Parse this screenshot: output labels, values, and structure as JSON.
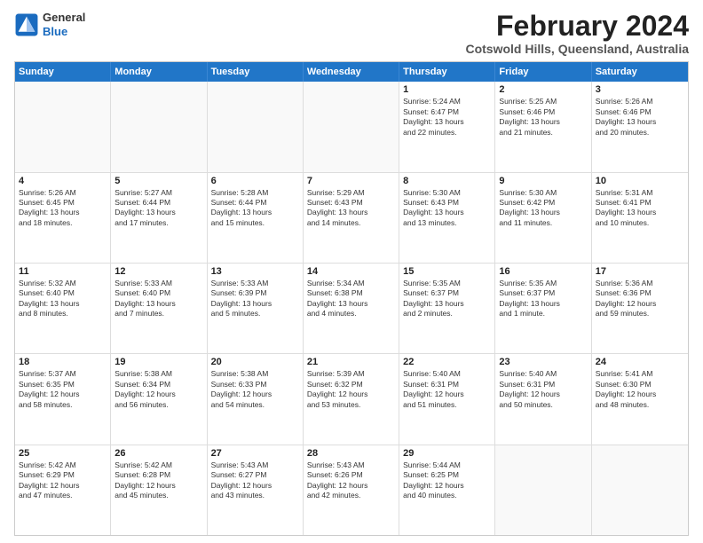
{
  "logo": {
    "line1": "General",
    "line2": "Blue"
  },
  "title": "February 2024",
  "subtitle": "Cotswold Hills, Queensland, Australia",
  "days": [
    "Sunday",
    "Monday",
    "Tuesday",
    "Wednesday",
    "Thursday",
    "Friday",
    "Saturday"
  ],
  "rows": [
    [
      {
        "day": "",
        "text": ""
      },
      {
        "day": "",
        "text": ""
      },
      {
        "day": "",
        "text": ""
      },
      {
        "day": "",
        "text": ""
      },
      {
        "day": "1",
        "text": "Sunrise: 5:24 AM\nSunset: 6:47 PM\nDaylight: 13 hours\nand 22 minutes."
      },
      {
        "day": "2",
        "text": "Sunrise: 5:25 AM\nSunset: 6:46 PM\nDaylight: 13 hours\nand 21 minutes."
      },
      {
        "day": "3",
        "text": "Sunrise: 5:26 AM\nSunset: 6:46 PM\nDaylight: 13 hours\nand 20 minutes."
      }
    ],
    [
      {
        "day": "4",
        "text": "Sunrise: 5:26 AM\nSunset: 6:45 PM\nDaylight: 13 hours\nand 18 minutes."
      },
      {
        "day": "5",
        "text": "Sunrise: 5:27 AM\nSunset: 6:44 PM\nDaylight: 13 hours\nand 17 minutes."
      },
      {
        "day": "6",
        "text": "Sunrise: 5:28 AM\nSunset: 6:44 PM\nDaylight: 13 hours\nand 15 minutes."
      },
      {
        "day": "7",
        "text": "Sunrise: 5:29 AM\nSunset: 6:43 PM\nDaylight: 13 hours\nand 14 minutes."
      },
      {
        "day": "8",
        "text": "Sunrise: 5:30 AM\nSunset: 6:43 PM\nDaylight: 13 hours\nand 13 minutes."
      },
      {
        "day": "9",
        "text": "Sunrise: 5:30 AM\nSunset: 6:42 PM\nDaylight: 13 hours\nand 11 minutes."
      },
      {
        "day": "10",
        "text": "Sunrise: 5:31 AM\nSunset: 6:41 PM\nDaylight: 13 hours\nand 10 minutes."
      }
    ],
    [
      {
        "day": "11",
        "text": "Sunrise: 5:32 AM\nSunset: 6:40 PM\nDaylight: 13 hours\nand 8 minutes."
      },
      {
        "day": "12",
        "text": "Sunrise: 5:33 AM\nSunset: 6:40 PM\nDaylight: 13 hours\nand 7 minutes."
      },
      {
        "day": "13",
        "text": "Sunrise: 5:33 AM\nSunset: 6:39 PM\nDaylight: 13 hours\nand 5 minutes."
      },
      {
        "day": "14",
        "text": "Sunrise: 5:34 AM\nSunset: 6:38 PM\nDaylight: 13 hours\nand 4 minutes."
      },
      {
        "day": "15",
        "text": "Sunrise: 5:35 AM\nSunset: 6:37 PM\nDaylight: 13 hours\nand 2 minutes."
      },
      {
        "day": "16",
        "text": "Sunrise: 5:35 AM\nSunset: 6:37 PM\nDaylight: 13 hours\nand 1 minute."
      },
      {
        "day": "17",
        "text": "Sunrise: 5:36 AM\nSunset: 6:36 PM\nDaylight: 12 hours\nand 59 minutes."
      }
    ],
    [
      {
        "day": "18",
        "text": "Sunrise: 5:37 AM\nSunset: 6:35 PM\nDaylight: 12 hours\nand 58 minutes."
      },
      {
        "day": "19",
        "text": "Sunrise: 5:38 AM\nSunset: 6:34 PM\nDaylight: 12 hours\nand 56 minutes."
      },
      {
        "day": "20",
        "text": "Sunrise: 5:38 AM\nSunset: 6:33 PM\nDaylight: 12 hours\nand 54 minutes."
      },
      {
        "day": "21",
        "text": "Sunrise: 5:39 AM\nSunset: 6:32 PM\nDaylight: 12 hours\nand 53 minutes."
      },
      {
        "day": "22",
        "text": "Sunrise: 5:40 AM\nSunset: 6:31 PM\nDaylight: 12 hours\nand 51 minutes."
      },
      {
        "day": "23",
        "text": "Sunrise: 5:40 AM\nSunset: 6:31 PM\nDaylight: 12 hours\nand 50 minutes."
      },
      {
        "day": "24",
        "text": "Sunrise: 5:41 AM\nSunset: 6:30 PM\nDaylight: 12 hours\nand 48 minutes."
      }
    ],
    [
      {
        "day": "25",
        "text": "Sunrise: 5:42 AM\nSunset: 6:29 PM\nDaylight: 12 hours\nand 47 minutes."
      },
      {
        "day": "26",
        "text": "Sunrise: 5:42 AM\nSunset: 6:28 PM\nDaylight: 12 hours\nand 45 minutes."
      },
      {
        "day": "27",
        "text": "Sunrise: 5:43 AM\nSunset: 6:27 PM\nDaylight: 12 hours\nand 43 minutes."
      },
      {
        "day": "28",
        "text": "Sunrise: 5:43 AM\nSunset: 6:26 PM\nDaylight: 12 hours\nand 42 minutes."
      },
      {
        "day": "29",
        "text": "Sunrise: 5:44 AM\nSunset: 6:25 PM\nDaylight: 12 hours\nand 40 minutes."
      },
      {
        "day": "",
        "text": ""
      },
      {
        "day": "",
        "text": ""
      }
    ]
  ]
}
